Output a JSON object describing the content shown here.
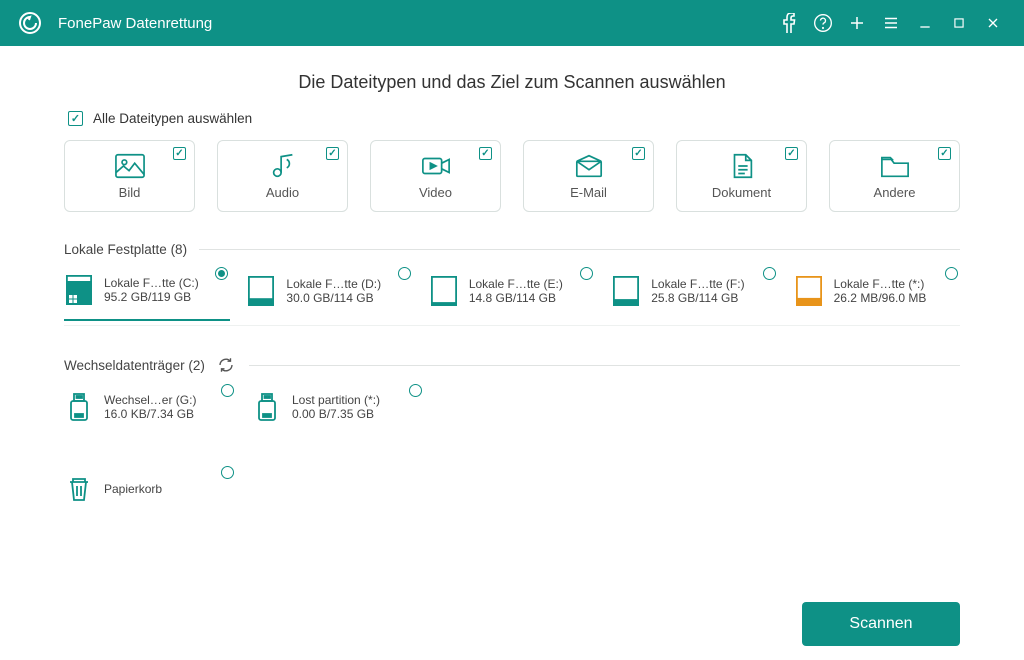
{
  "app_title": "FonePaw Datenrettung",
  "page_heading": "Die Dateitypen und das Ziel zum Scannen auswählen",
  "select_all_label": "Alle Dateitypen auswählen",
  "file_types": {
    "image": "Bild",
    "audio": "Audio",
    "video": "Video",
    "email": "E-Mail",
    "document": "Dokument",
    "other": "Andere"
  },
  "sections": {
    "local": "Lokale Festplatte (8)",
    "removable": "Wechseldatenträger (2)"
  },
  "drives_local": [
    {
      "name": "Lokale F…tte (C:)",
      "size": "95.2 GB/119 GB",
      "selected": true,
      "color": "teal",
      "fill": 0.8
    },
    {
      "name": "Lokale F…tte (D:)",
      "size": "30.0 GB/114 GB",
      "selected": false,
      "color": "teal",
      "fill": 0.26
    },
    {
      "name": "Lokale F…tte (E:)",
      "size": "14.8 GB/114 GB",
      "selected": false,
      "color": "teal",
      "fill": 0.13
    },
    {
      "name": "Lokale F…tte (F:)",
      "size": "25.8 GB/114 GB",
      "selected": false,
      "color": "teal",
      "fill": 0.23
    },
    {
      "name": "Lokale F…tte (*:)",
      "size": "26.2 MB/96.0 MB",
      "selected": false,
      "color": "orange",
      "fill": 0.27
    }
  ],
  "drives_removable": [
    {
      "name": "Wechsel…er (G:)",
      "size": "16.0 KB/7.34 GB"
    },
    {
      "name": "Lost partition (*:)",
      "size": "0.00  B/7.35 GB"
    }
  ],
  "recycle_label": "Papierkorb",
  "scan_button": "Scannen"
}
